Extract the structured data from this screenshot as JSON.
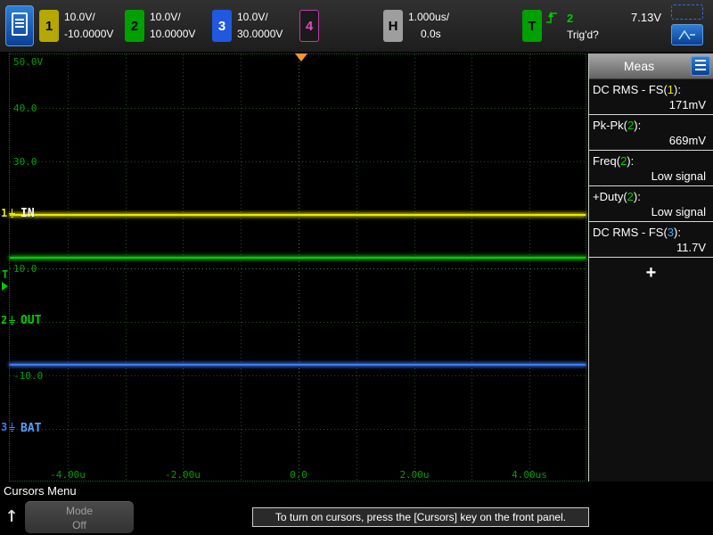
{
  "top_bar": {
    "channels": [
      {
        "num": "1",
        "scale": "10.0V/",
        "offset": "-10.0000V",
        "bg": "#b5a800",
        "fg": "#000000",
        "border": "#b5a800"
      },
      {
        "num": "2",
        "scale": "10.0V/",
        "offset": "10.0000V",
        "bg": "#00a000",
        "fg": "#000000",
        "border": "#00a000"
      },
      {
        "num": "3",
        "scale": "10.0V/",
        "offset": "30.0000V",
        "bg": "#2158e0",
        "fg": "#ffffff",
        "border": "#2158e0"
      },
      {
        "num": "4",
        "scale": "",
        "offset": "",
        "bg": "#1a1a1a",
        "fg": "#e649c8",
        "border": "#c03ba5"
      }
    ],
    "horizontal": {
      "key": "H",
      "scale": "1.000us/",
      "delay": "0.0s",
      "bg": "#9e9e9e",
      "fg": "#000000"
    },
    "trigger": {
      "key": "T",
      "source": "2",
      "level": "7.13V",
      "status": "Trig'd?",
      "bg": "#00a000",
      "fg": "#000000",
      "color": "#00c800"
    }
  },
  "graticule": {
    "y_labels": [
      "50.0V",
      "40.0",
      "30.0",
      "10.0",
      "-10.0"
    ],
    "x_labels": [
      "-4.00u",
      "-2.00u",
      "0.0",
      "2.00u",
      "4.00us"
    ],
    "label_color": "#00a000"
  },
  "traces": [
    {
      "name": "IN",
      "marker": "1",
      "color": "#e8e800",
      "label_color": "#ffffff"
    },
    {
      "name": "OUT",
      "marker": "2",
      "color": "#00d000",
      "label_color": "#00d000"
    },
    {
      "name": "BAT",
      "marker": "3",
      "color": "#3d7bff",
      "label_color": "#55a0ff"
    }
  ],
  "trigger_marker": {
    "label": "T",
    "color": "#00c800",
    "position_color": "#ff9632"
  },
  "sidebar": {
    "title": "Meas",
    "measurements": [
      {
        "prefix": "DC RMS - FS(",
        "ch": "1",
        "suffix": "):",
        "value": "171mV",
        "ch_color": "#e8e800"
      },
      {
        "prefix": "Pk-Pk(",
        "ch": "2",
        "suffix": "):",
        "value": "669mV",
        "ch_color": "#00d000"
      },
      {
        "prefix": "Freq(",
        "ch": "2",
        "suffix": "):",
        "value": "Low signal",
        "ch_color": "#00d000"
      },
      {
        "prefix": "+Duty(",
        "ch": "2",
        "suffix": "):",
        "value": "Low signal",
        "ch_color": "#00d000"
      },
      {
        "prefix": "DC RMS - FS(",
        "ch": "3",
        "suffix": "):",
        "value": "11.7V",
        "ch_color": "#55a0ff"
      }
    ],
    "add_button": "+"
  },
  "bottom_bar": {
    "menu_title": "Cursors Menu",
    "back_arrow": "↑",
    "softkey": {
      "line1": "Mode",
      "line2": "Off"
    },
    "message": "To turn on cursors, press the [Cursors] key on the front panel."
  }
}
